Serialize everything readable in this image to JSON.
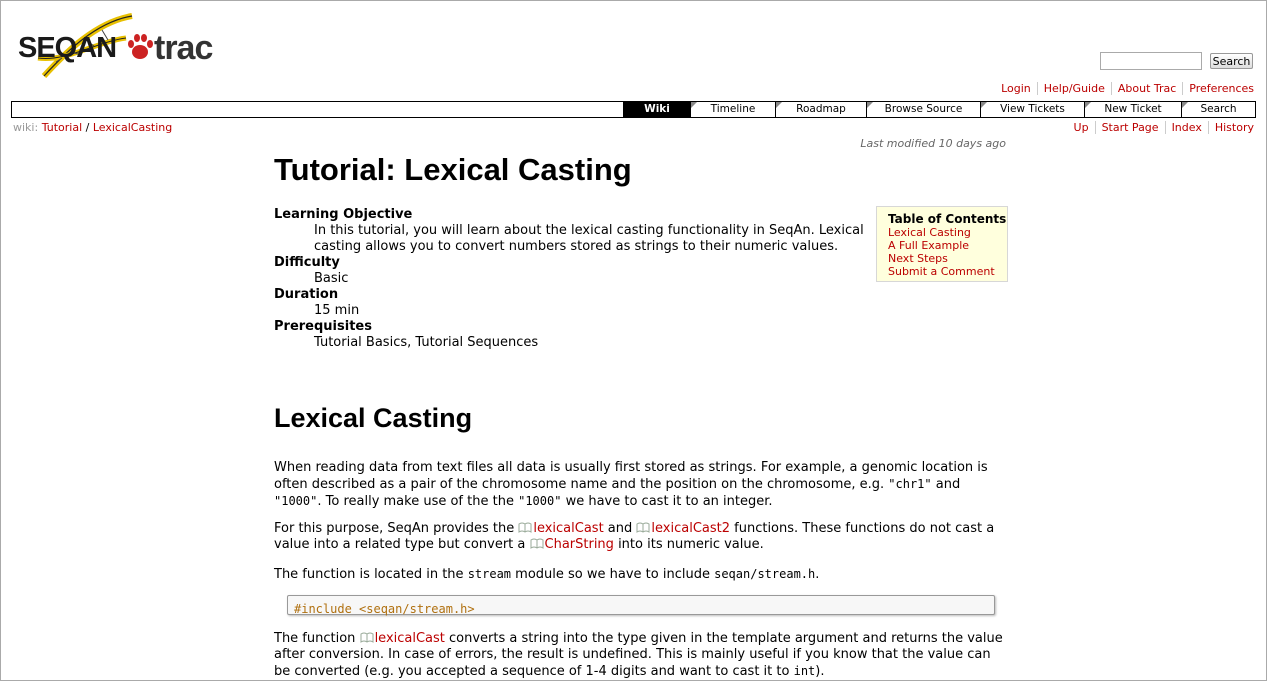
{
  "header": {
    "logo_text": "SEQAN trac",
    "search_placeholder": "",
    "search_button": "Search"
  },
  "metanav": [
    "Login",
    "Help/Guide",
    "About Trac",
    "Preferences"
  ],
  "mainnav": [
    {
      "label": "Wiki",
      "active": true
    },
    {
      "label": "Timeline",
      "active": false
    },
    {
      "label": "Roadmap",
      "active": false
    },
    {
      "label": "Browse Source",
      "active": false
    },
    {
      "label": "View Tickets",
      "active": false
    },
    {
      "label": "New Ticket",
      "active": false
    },
    {
      "label": "Search",
      "active": false
    }
  ],
  "breadcrumb": {
    "prefix": "wiki:",
    "items": [
      "Tutorial",
      "LexicalCasting"
    ],
    "separator": "/"
  },
  "ctxtnav": [
    "Up",
    "Start Page",
    "Index",
    "History"
  ],
  "last_modified": "Last modified 10 days ago",
  "page": {
    "title": "Tutorial: Lexical Casting",
    "definitions": [
      {
        "term": "Learning Objective",
        "desc": "In this tutorial, you will learn about the lexical casting functionality in SeqAn. Lexical casting allows you to convert numbers stored as strings to their numeric values."
      },
      {
        "term": "Difficulty",
        "desc": "Basic"
      },
      {
        "term": "Duration",
        "desc": "15 min"
      },
      {
        "term": "Prerequisites",
        "desc": "Tutorial Basics, Tutorial Sequences"
      }
    ],
    "toc": {
      "title": "Table of Contents",
      "items": [
        "Lexical Casting",
        "A Full Example",
        "Next Steps",
        "Submit a Comment"
      ]
    },
    "section_title": "Lexical Casting",
    "p1": {
      "t1": "When reading data from text files all data is usually first stored as strings. For example, a genomic location is often described as a pair of the chromosome name and the position on the chromosome, e.g. ",
      "c1": "\"chr1\"",
      "t2": " and ",
      "c2": "\"1000\"",
      "t3": ". To really make use of the the ",
      "c3": "\"1000\"",
      "t4": " we have to cast it to an integer."
    },
    "p2": {
      "t1": "For this purpose, SeqAn provides the ",
      "l1": "lexicalCast",
      "t2": " and ",
      "l2": "lexicalCast2",
      "t3": " functions. These functions do not cast a value into a related type but convert a ",
      "l3": "CharString",
      "t4": " into its numeric value."
    },
    "p3": {
      "t1": "The function is located in the ",
      "c1": "stream",
      "t2": " module so we have to include ",
      "c2": "seqan/stream.h",
      "t3": "."
    },
    "code": "#include <seqan/stream.h>",
    "p4": {
      "t1": "The function ",
      "l1": "lexicalCast",
      "t2": " converts a string into the type given in the template argument and returns the value after conversion. In case of errors, the result is undefined. This is mainly useful if you know that the value can be converted (e.g. you accepted a sequence of 1-4 digits and want to cast it to ",
      "c1": "int",
      "t3": ")."
    }
  },
  "colors": {
    "link": "#bb0000",
    "toc_bg": "#ffffdd",
    "nav_active_bg": "#000000",
    "code_keyword": "#b0700f"
  },
  "icons": {
    "logo_paw": "paw-icon",
    "logo_helix": "dna-helix-icon",
    "doc_link": "book-icon"
  }
}
